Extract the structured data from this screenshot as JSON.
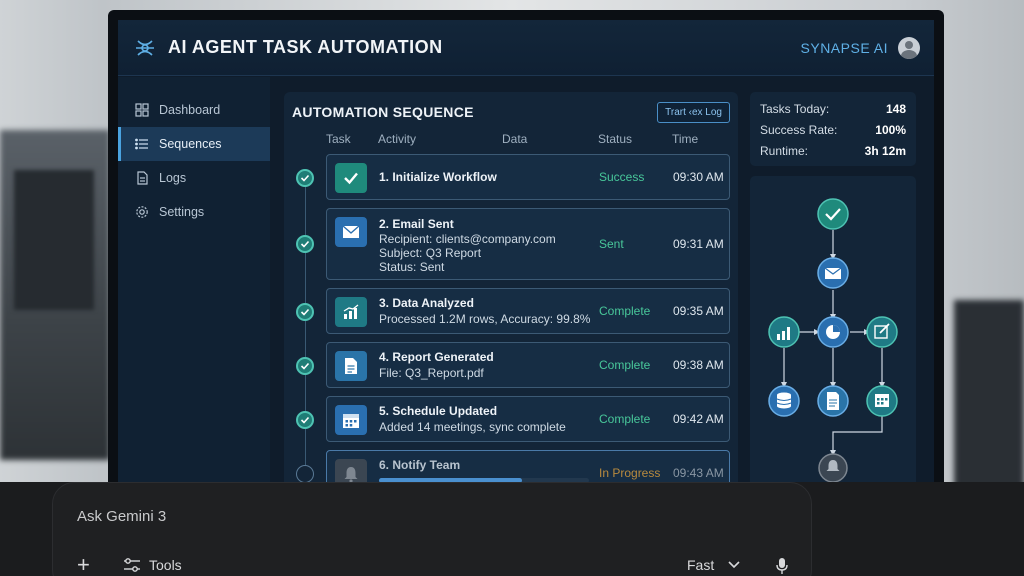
{
  "app": {
    "title": "AI AGENT TASK AUTOMATION",
    "brand": "SYNAPSE AI",
    "logo_icon": "neural-network-icon",
    "avatar_icon": "user-avatar-icon"
  },
  "sidebar": {
    "items": [
      {
        "label": "Dashboard",
        "icon": "dashboard-grid-icon",
        "active": false
      },
      {
        "label": "Sequences",
        "icon": "list-icon",
        "active": true
      },
      {
        "label": "Logs",
        "icon": "document-icon",
        "active": false
      },
      {
        "label": "Settings",
        "icon": "gear-icon",
        "active": false
      }
    ]
  },
  "main": {
    "title": "AUTOMATION SEQUENCE",
    "log_button": "Trart ‹ex Log",
    "columns": [
      "Task",
      "Activity",
      "Data",
      "Status",
      "Time"
    ],
    "steps": [
      {
        "title": "1. Initialize Workflow",
        "lines": [],
        "status": "Success",
        "time": "09:30 AM",
        "icon": "checkmark-icon",
        "state": "done"
      },
      {
        "title": "2. Email Sent",
        "lines": [
          "Recipient: clients@company.com",
          "Subject: Q3 Report",
          "Status: Sent"
        ],
        "status": "Sent",
        "time": "09:31 AM",
        "icon": "envelope-icon",
        "state": "done"
      },
      {
        "title": "3. Data Analyzed",
        "lines": [
          "Processed 1.2M rows, Accuracy: 99.8%"
        ],
        "status": "Complete",
        "time": "09:35 AM",
        "icon": "chart-icon",
        "state": "done"
      },
      {
        "title": "4. Report Generated",
        "lines": [
          "File: Q3_Report.pdf"
        ],
        "status": "Complete",
        "time": "09:38 AM",
        "icon": "file-icon",
        "state": "done"
      },
      {
        "title": "5. Schedule Updated",
        "lines": [
          "Added 14 meetings, sync complete"
        ],
        "status": "Complete",
        "time": "09:42 AM",
        "icon": "calendar-icon",
        "state": "done"
      },
      {
        "title": "6. Notify Team",
        "lines": [],
        "status": "In Progress",
        "time": "09:43 AM",
        "icon": "bell-icon",
        "state": "in-progress",
        "progress": 0.68
      }
    ]
  },
  "stats": [
    {
      "label": "Tasks Today:",
      "value": "148"
    },
    {
      "label": "Success Rate:",
      "value": "100%"
    },
    {
      "label": "Runtime:",
      "value": "3h 12m"
    }
  ],
  "colors": {
    "accent": "#4aa3e0",
    "success": "#48c79a",
    "teal": "#1f7d76",
    "in_progress": "#b88a3e"
  },
  "gemini": {
    "placeholder": "Ask Gemini 3",
    "tools_label": "Tools",
    "mode_label": "Fast",
    "plus_icon": "plus-icon",
    "tools_icon": "sliders-icon",
    "mode_icon": "chevron-down-icon",
    "mic_icon": "microphone-icon"
  }
}
